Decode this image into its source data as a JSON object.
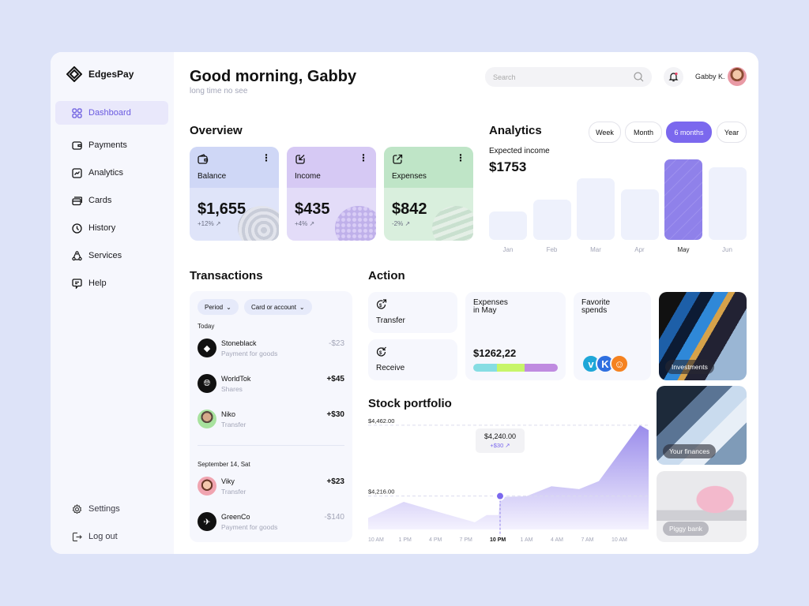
{
  "brand": {
    "name": "EdgesPay"
  },
  "sidebar": {
    "items": [
      {
        "label": "Dashboard",
        "icon": "grid-icon",
        "active": true
      },
      {
        "label": "Payments",
        "icon": "wallet-icon"
      },
      {
        "label": "Analytics",
        "icon": "chart-icon"
      },
      {
        "label": "Cards",
        "icon": "cards-icon"
      },
      {
        "label": "History",
        "icon": "clock-icon"
      },
      {
        "label": "Services",
        "icon": "services-icon"
      },
      {
        "label": "Help",
        "icon": "help-chat-icon"
      }
    ],
    "footer": [
      {
        "label": "Settings",
        "icon": "gear-icon"
      },
      {
        "label": "Log out",
        "icon": "logout-icon"
      }
    ]
  },
  "header": {
    "greeting": "Good morning, Gabby",
    "subtitle": "long time no see",
    "search_placeholder": "Search",
    "user_name": "Gabby K."
  },
  "overview": {
    "title": "Overview",
    "cards": [
      {
        "label": "Balance",
        "value": "$1,655",
        "change": "+12%",
        "icon": "wallet-icon"
      },
      {
        "label": "Income",
        "value": "$435",
        "change": "+4%",
        "icon": "arrow-down-left-icon"
      },
      {
        "label": "Expenses",
        "value": "$842",
        "change": "-2%",
        "icon": "arrow-up-right-icon"
      }
    ]
  },
  "analytics": {
    "title": "Analytics",
    "periods": [
      "Week",
      "Month",
      "6 months",
      "Year"
    ],
    "active_period": "6 months",
    "expected_label": "Expected income",
    "expected_value": "$1753",
    "accent": "#7b68ee"
  },
  "transactions": {
    "title": "Transactions",
    "filters": [
      "Period",
      "Card or account"
    ],
    "groups": [
      {
        "label": "Today",
        "items": [
          {
            "name": "Stoneblack",
            "sub": "Payment for goods",
            "amount": "-$23",
            "negative": true,
            "icon": "ethereum-icon"
          },
          {
            "name": "WorldTok",
            "sub": "Shares",
            "amount": "+$45",
            "negative": false,
            "icon": "globe-icon"
          },
          {
            "name": "Niko",
            "sub": "Transfer",
            "amount": "+$30",
            "negative": false,
            "icon": "avatar"
          }
        ]
      },
      {
        "label": "September 14, Sat",
        "items": [
          {
            "name": "Viky",
            "sub": "Transfer",
            "amount": "+$23",
            "negative": false,
            "icon": "avatar"
          },
          {
            "name": "GreenCo",
            "sub": "Payment for goods",
            "amount": "-$140",
            "negative": true,
            "icon": "plane-icon"
          }
        ]
      }
    ]
  },
  "action": {
    "title": "Action",
    "transfer": "Transfer",
    "receive": "Receive",
    "expenses_title_1": "Expenses",
    "expenses_title_2": "in May",
    "expenses_value": "$1262,22",
    "expense_split": [
      {
        "color": "#86dde3",
        "share": 0.28
      },
      {
        "color": "#c7f56a",
        "share": 0.33
      },
      {
        "color": "#bf8be0",
        "share": 0.39
      }
    ],
    "favorite_title_1": "Favorite",
    "favorite_title_2": "spends",
    "favorites": [
      {
        "name": "vimeo-icon",
        "glyph": "v",
        "color": "#1fa7d8"
      },
      {
        "name": "vk-icon",
        "glyph": "K",
        "color": "#2f6fe0"
      },
      {
        "name": "snapchat-icon",
        "glyph": "☺",
        "color": "#f58220"
      }
    ]
  },
  "stock": {
    "title": "Stock portfolio",
    "tooltip_value": "$4,240.00",
    "tooltip_change": "+$30"
  },
  "promos": [
    "Investments",
    "Your finances",
    "Piggy bank"
  ],
  "chart_data": [
    {
      "type": "bar",
      "title": "Expected income",
      "categories": [
        "Jan",
        "Feb",
        "Mar",
        "Apr",
        "May",
        "Jun"
      ],
      "values": [
        35,
        50,
        76,
        63,
        100,
        90
      ],
      "highlight": "May",
      "ylim": [
        0,
        100
      ]
    },
    {
      "type": "area",
      "title": "Stock portfolio",
      "x": [
        "10 AM",
        "1 PM",
        "4 PM",
        "7 PM",
        "10 PM",
        "1 AM",
        "4 AM",
        "7 AM",
        "10 AM"
      ],
      "highlight_x": "10 PM",
      "y_ticks": [
        "$4,462.00",
        "$4,216.00"
      ],
      "series": [
        {
          "name": "Portfolio",
          "values": [
            4140,
            4195,
            4160,
            4125,
            4175,
            4230,
            4262,
            4235,
            4275,
            4225,
            4470,
            4440
          ]
        }
      ],
      "ylim": [
        4100,
        4470
      ]
    }
  ]
}
